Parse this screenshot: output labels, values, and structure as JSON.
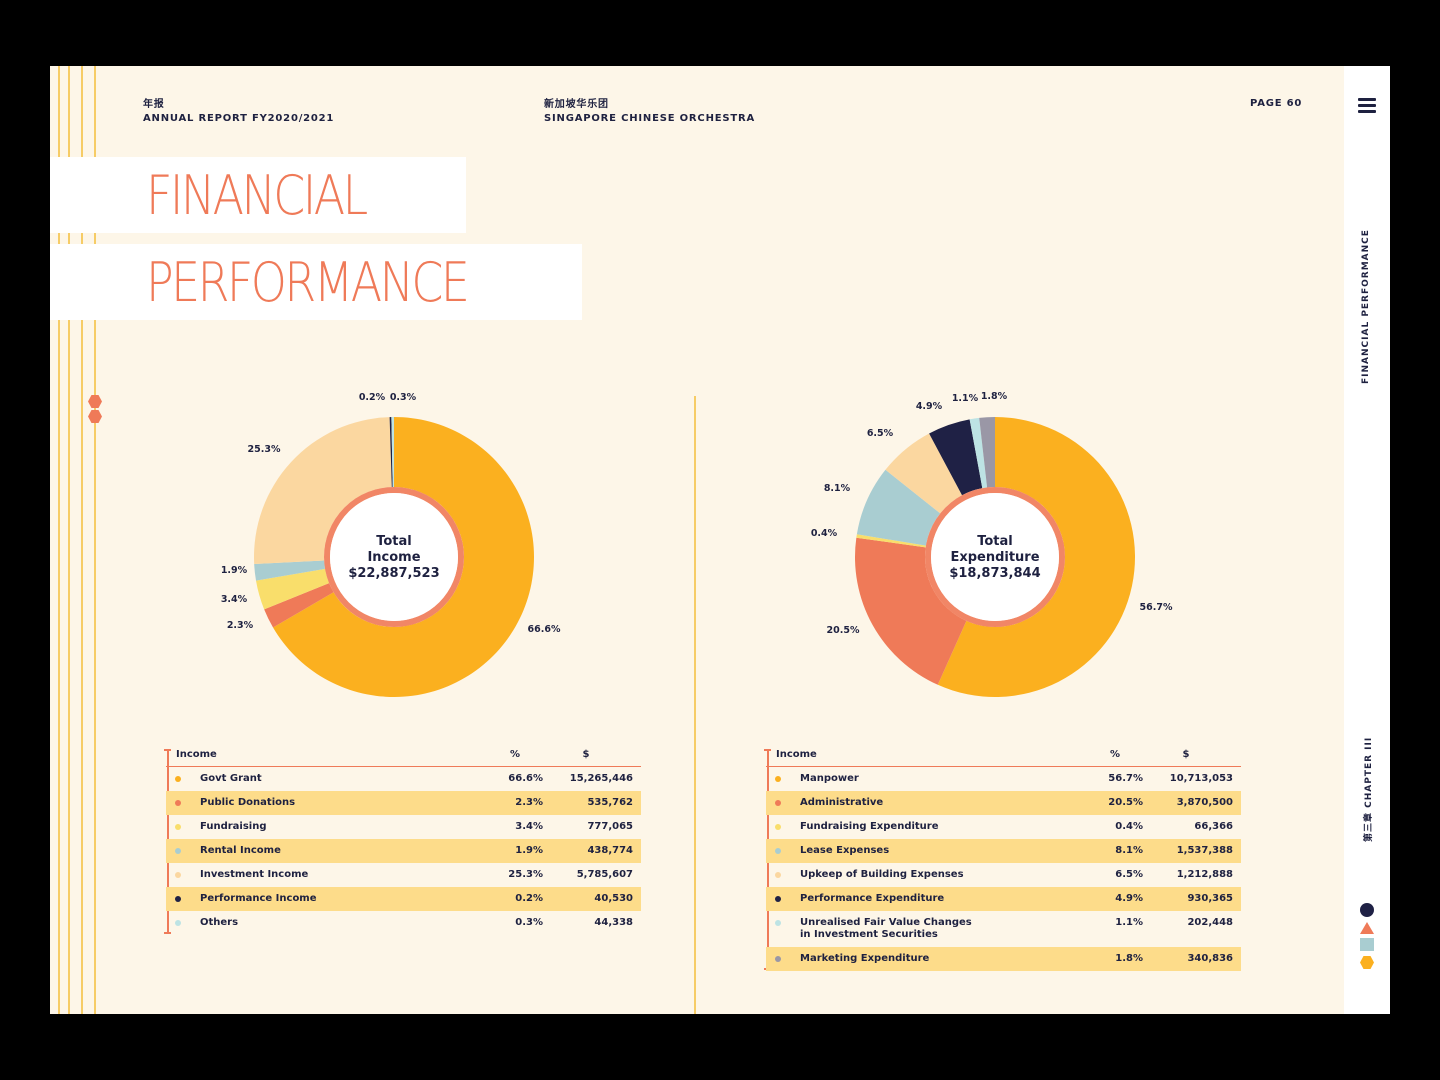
{
  "header": {
    "left_cn": "年报",
    "left_en": "ANNUAL REPORT FY2020/2021",
    "center_cn": "新加坡华乐团",
    "center_en": "SINGAPORE CHINESE ORCHESTRA",
    "page": "PAGE 60"
  },
  "title": {
    "line1": "FINANCIAL",
    "line2": "PERFORMANCE"
  },
  "sidebar": {
    "section": "FINANCIAL PERFORMANCE",
    "chapter": "第三章  CHAPTER III"
  },
  "colors": {
    "yellow": "#fbb01f",
    "coral": "#ef7a58",
    "pale_yellow": "#f9de6b",
    "light_blue": "#a9cdd1",
    "peach": "#fbd7a0",
    "navy": "#1f2145",
    "pale_cyan": "#bde3e4",
    "grey": "#9a97a6",
    "background": "#fdf6e8"
  },
  "chart_data": [
    {
      "type": "pie",
      "center_label_1": "Total",
      "center_label_2": "Income",
      "center_total": "$22,887,523",
      "table_header": {
        "label": "Income",
        "pct": "%",
        "amt": "$"
      },
      "series": [
        {
          "name": "Govt Grant",
          "pct": 66.6,
          "pct_label": "66.6%",
          "amount": "15,265,446",
          "color": "#fbb01f"
        },
        {
          "name": "Public Donations",
          "pct": 2.3,
          "pct_label": "2.3%",
          "amount": "535,762",
          "color": "#ef7a58"
        },
        {
          "name": "Fundraising",
          "pct": 3.4,
          "pct_label": "3.4%",
          "amount": "777,065",
          "color": "#f9de6b"
        },
        {
          "name": "Rental Income",
          "pct": 1.9,
          "pct_label": "1.9%",
          "amount": "438,774",
          "color": "#a9cdd1"
        },
        {
          "name": "Investment Income",
          "pct": 25.3,
          "pct_label": "25.3%",
          "amount": "5,785,607",
          "color": "#fbd7a0"
        },
        {
          "name": "Performance Income",
          "pct": 0.2,
          "pct_label": "0.2%",
          "amount": "40,530",
          "color": "#1f2145"
        },
        {
          "name": "Others",
          "pct": 0.3,
          "pct_label": "0.3%",
          "amount": "44,338",
          "color": "#bde3e4"
        }
      ]
    },
    {
      "type": "pie",
      "center_label_1": "Total",
      "center_label_2": "Expenditure",
      "center_total": "$18,873,844",
      "table_header": {
        "label": "Income",
        "pct": "%",
        "amt": "$"
      },
      "series": [
        {
          "name": "Manpower",
          "pct": 56.7,
          "pct_label": "56.7%",
          "amount": "10,713,053",
          "color": "#fbb01f"
        },
        {
          "name": "Administrative",
          "pct": 20.5,
          "pct_label": "20.5%",
          "amount": "3,870,500",
          "color": "#ef7a58"
        },
        {
          "name": "Fundraising Expenditure",
          "pct": 0.4,
          "pct_label": "0.4%",
          "amount": "66,366",
          "color": "#f9de6b"
        },
        {
          "name": "Lease Expenses",
          "pct": 8.1,
          "pct_label": "8.1%",
          "amount": "1,537,388",
          "color": "#a9cdd1"
        },
        {
          "name": "Upkeep of Building Expenses",
          "pct": 6.5,
          "pct_label": "6.5%",
          "amount": "1,212,888",
          "color": "#fbd7a0"
        },
        {
          "name": "Performance Expenditure",
          "pct": 4.9,
          "pct_label": "4.9%",
          "amount": "930,365",
          "color": "#1f2145"
        },
        {
          "name": "Unrealised Fair Value Changes in Investment Securities",
          "name_line1": "Unrealised Fair Value Changes",
          "name_line2": "in Investment Securities",
          "pct": 1.1,
          "pct_label": "1.1%",
          "amount": "202,448",
          "color": "#bde3e4"
        },
        {
          "name": "Marketing Expenditure",
          "pct": 1.8,
          "pct_label": "1.8%",
          "amount": "340,836",
          "color": "#9a97a6"
        }
      ]
    }
  ]
}
